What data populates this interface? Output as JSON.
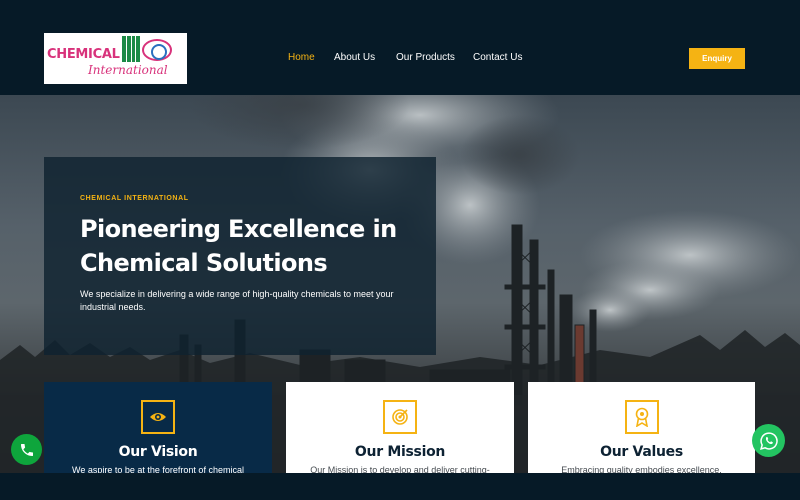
{
  "brand": {
    "logo_line1": "CHEMICAL",
    "logo_line2": "International",
    "logo_color": "#d8327b"
  },
  "nav": {
    "items": [
      {
        "label": "Home",
        "active": true
      },
      {
        "label": "About Us",
        "active": false
      },
      {
        "label": "Our Products",
        "active": false
      },
      {
        "label": "Contact Us",
        "active": false
      }
    ],
    "cta_label": "Enquiry"
  },
  "hero": {
    "kicker": "CHEMICAL INTERNATIONAL",
    "title": "Pioneering Excellence in Chemical Solutions",
    "description": "We specialize in delivering a wide range of high-quality chemicals to meet your industrial needs."
  },
  "cards": [
    {
      "title": "Our Vision",
      "text": "We aspire to be at the forefront of chemical",
      "icon": "eye-icon"
    },
    {
      "title": "Our Mission",
      "text": "Our Mission is to develop and deliver cutting-",
      "icon": "target-icon"
    },
    {
      "title": "Our Values",
      "text": "Embracing quality embodies excellence,",
      "icon": "award-icon"
    }
  ],
  "floating": {
    "call_icon": "phone-icon",
    "chat_icon": "whatsapp-icon"
  },
  "colors": {
    "accent": "#f5b313",
    "header_bg": "#061a27",
    "vision_card_bg": "#082a47",
    "call_green": "#0ea53c",
    "whatsapp_green": "#23c461"
  }
}
